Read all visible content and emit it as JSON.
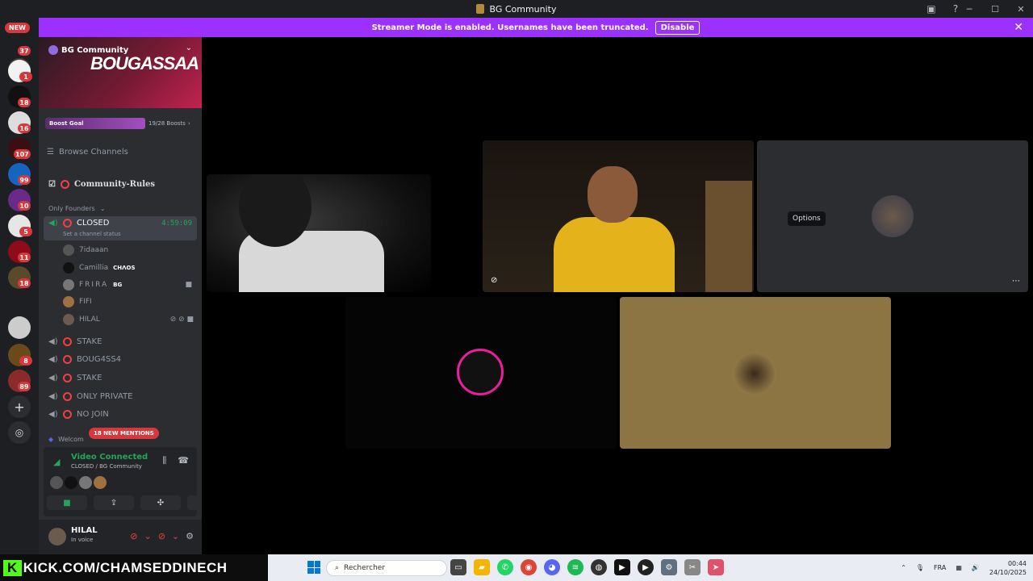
{
  "window": {
    "title": "BG Community"
  },
  "banner": {
    "text": "Streamer Mode is enabled. Usernames have been truncated.",
    "disable_label": "Disable"
  },
  "rail": {
    "new_label": "NEW",
    "badges": [
      "37",
      "1",
      "18",
      "16",
      "107",
      "99",
      "10",
      "5",
      "11",
      "18",
      "8",
      "89"
    ]
  },
  "server": {
    "name": "BG Community",
    "banner_text": "BOUGASSAA",
    "boost_label": "Boost Goal",
    "boost_count": "19/28 Boosts",
    "boost_progress": 0.68,
    "browse_label": "Browse Channels",
    "rules_channel": "Community-Rules",
    "category": "Only Founders"
  },
  "active_channel": {
    "name": "CLOSED",
    "timer": "4:59:09",
    "status": "Set a channel status"
  },
  "voice_users": [
    {
      "name": "7idaaan",
      "tag": ""
    },
    {
      "name": "Camillia",
      "tag": "CHΛOS"
    },
    {
      "name": "FRIRA",
      "tag": "BG"
    },
    {
      "name": "FIFI",
      "tag": ""
    },
    {
      "name": "HILAL",
      "tag": ""
    }
  ],
  "channels": [
    "STAKE",
    "BOUG4SS4",
    "STAKE",
    "ONLY PRIVATE",
    "NO JOIN"
  ],
  "welcome_channel": "Welcom",
  "mentions_label": "18 NEW MENTIONS",
  "voice_panel": {
    "title": "Video Connected",
    "subtitle": "CLOSED / BG Community"
  },
  "user_panel": {
    "name": "HILAL",
    "status": "In voice"
  },
  "tooltip": "Options",
  "taskbar": {
    "overlay": "KICK.COM/CHAMSEDDINECH",
    "search_placeholder": "Rechercher",
    "lang": "FRA",
    "time": "00:44",
    "date": "24/10/2025"
  },
  "colors": {
    "accent": "#9b30ff",
    "danger": "#da373c",
    "online": "#23a55a",
    "sidebar": "#2b2d31"
  }
}
